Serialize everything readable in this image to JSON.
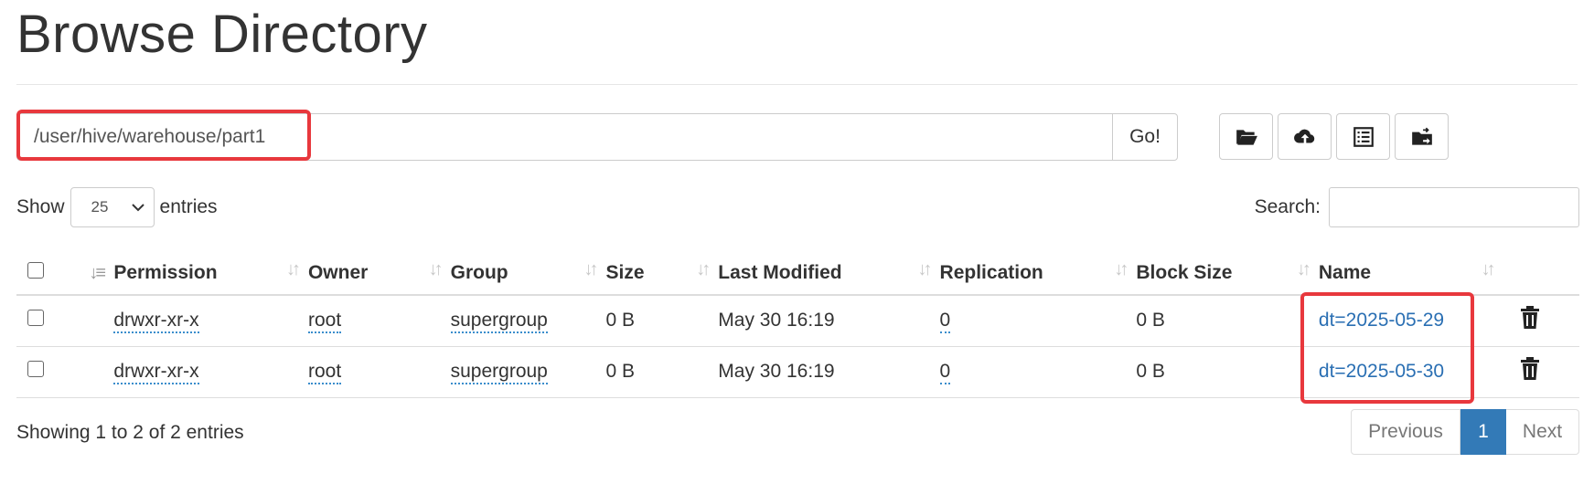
{
  "page_title": "Browse Directory",
  "path": {
    "value": "/user/hive/warehouse/part1",
    "go_label": "Go!"
  },
  "toolbar": {
    "icons": [
      "folder-open-icon",
      "cloud-upload-icon",
      "list-alt-icon",
      "folder-move-icon"
    ]
  },
  "show": {
    "prefix": "Show",
    "value": "25",
    "suffix": "entries"
  },
  "search": {
    "label": "Search:",
    "value": ""
  },
  "table": {
    "headers": [
      "Permission",
      "Owner",
      "Group",
      "Size",
      "Last Modified",
      "Replication",
      "Block Size",
      "Name"
    ],
    "rows": [
      {
        "permission": "drwxr-xr-x",
        "owner": "root",
        "group": "supergroup",
        "size": "0 B",
        "modified": "May 30 16:19",
        "replication": "0",
        "block_size": "0 B",
        "name": "dt=2025-05-29"
      },
      {
        "permission": "drwxr-xr-x",
        "owner": "root",
        "group": "supergroup",
        "size": "0 B",
        "modified": "May 30 16:19",
        "replication": "0",
        "block_size": "0 B",
        "name": "dt=2025-05-30"
      }
    ]
  },
  "footer": {
    "info": "Showing 1 to 2 of 2 entries",
    "previous": "Previous",
    "current_page": "1",
    "next": "Next"
  },
  "colors": {
    "link": "#2a6fb3",
    "active_page": "#337ab7",
    "highlight": "#e8383d"
  }
}
